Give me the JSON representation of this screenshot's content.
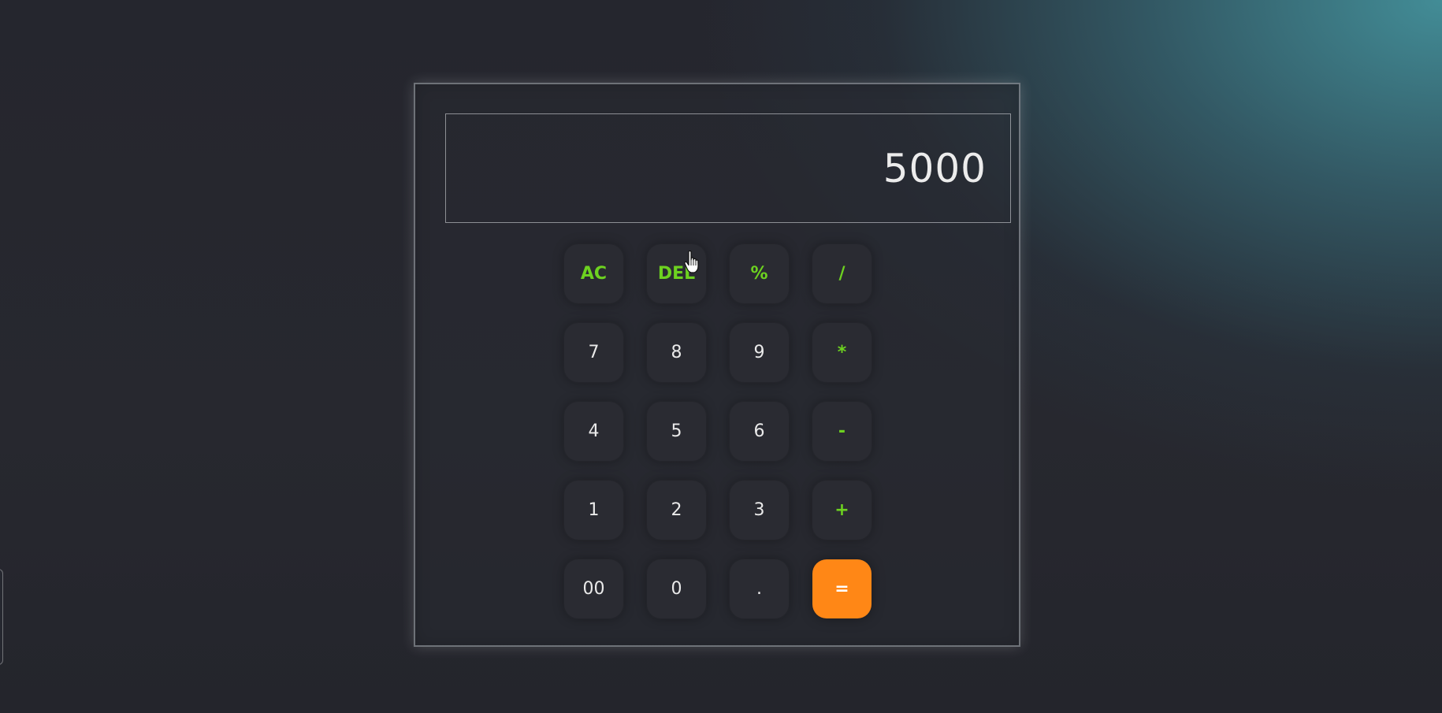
{
  "display": {
    "value": "5000"
  },
  "keys": [
    {
      "label": "AC",
      "type": "op"
    },
    {
      "label": "DEL",
      "type": "op"
    },
    {
      "label": "%",
      "type": "op"
    },
    {
      "label": "/",
      "type": "op"
    },
    {
      "label": "7",
      "type": "num"
    },
    {
      "label": "8",
      "type": "num"
    },
    {
      "label": "9",
      "type": "num"
    },
    {
      "label": "*",
      "type": "op"
    },
    {
      "label": "4",
      "type": "num"
    },
    {
      "label": "5",
      "type": "num"
    },
    {
      "label": "6",
      "type": "num"
    },
    {
      "label": "-",
      "type": "op"
    },
    {
      "label": "1",
      "type": "num"
    },
    {
      "label": "2",
      "type": "num"
    },
    {
      "label": "3",
      "type": "num"
    },
    {
      "label": "+",
      "type": "op"
    },
    {
      "label": "00",
      "type": "num"
    },
    {
      "label": "0",
      "type": "num"
    },
    {
      "label": ".",
      "type": "num"
    },
    {
      "label": "=",
      "type": "equals"
    }
  ],
  "colors": {
    "operator_text": "#6dd220",
    "equals_background": "#ff8716",
    "key_background": "#2a2b32",
    "display_text": "#ececec"
  },
  "cursor": {
    "icon": "hand-pointer-icon"
  }
}
